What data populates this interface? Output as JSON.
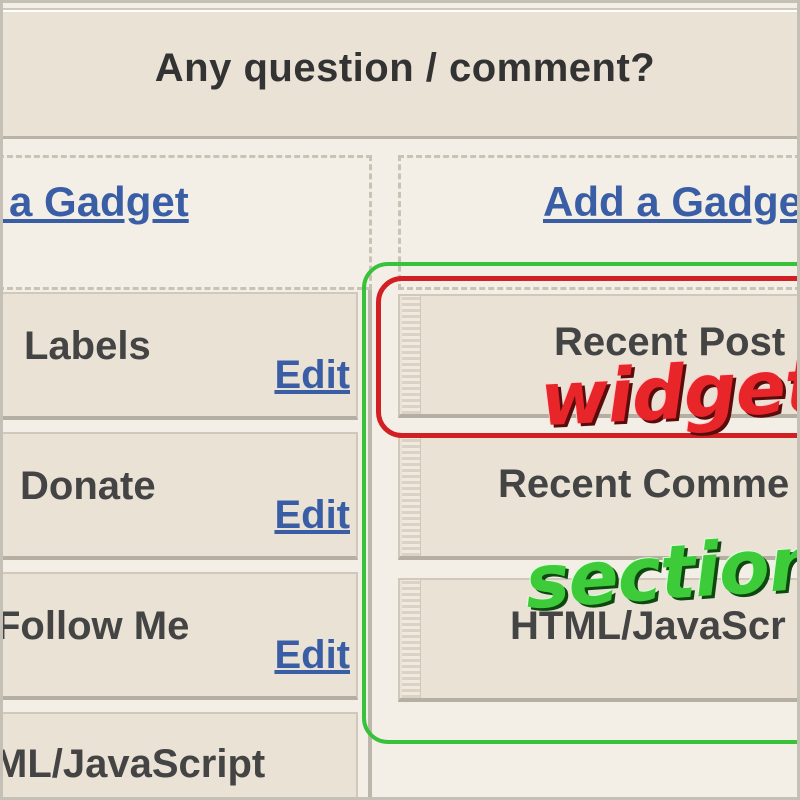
{
  "header": {
    "title": "Any question / comment?"
  },
  "left_column": {
    "add_gadget": "ld a Gadget",
    "gadgets": [
      {
        "title": "Labels",
        "edit": "Edit"
      },
      {
        "title": "Donate",
        "edit": "Edit"
      },
      {
        "title": "Follow Me",
        "edit": "Edit"
      },
      {
        "title": "ML/JavaScript"
      }
    ]
  },
  "right_column": {
    "add_gadget": "Add a Gadge",
    "gadgets": [
      {
        "title": "Recent Post"
      },
      {
        "title": "Recent Comme"
      },
      {
        "title": "HTML/JavaScr"
      }
    ]
  },
  "annotations": {
    "widget": "widget",
    "section": "section",
    "widget_color": "#d21f24",
    "section_color": "#38c23a"
  }
}
